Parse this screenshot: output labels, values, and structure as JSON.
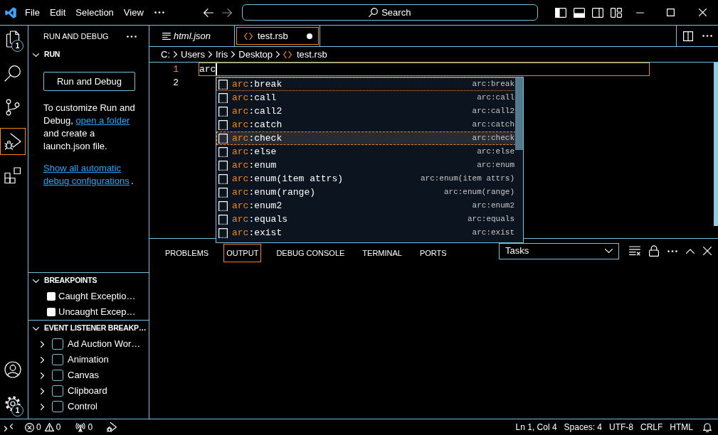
{
  "title_bar": {
    "menus": [
      {
        "label": "File"
      },
      {
        "label": "Edit"
      },
      {
        "label": "Selection"
      },
      {
        "label": "View"
      }
    ],
    "navigation": [
      {
        "kind": "back",
        "disabled": false
      },
      {
        "kind": "forward",
        "disabled": true
      }
    ],
    "search": {
      "label": "Search"
    },
    "layout_toggles": [
      {
        "kind": "primary_sidebar",
        "on": true
      },
      {
        "kind": "panel",
        "on": true
      },
      {
        "kind": "secondary_sidebar",
        "on": false
      }
    ]
  },
  "activity_bar": {
    "items": [
      {
        "kind": "explorer",
        "selected": false,
        "badge": "1"
      },
      {
        "kind": "search",
        "selected": false
      },
      {
        "kind": "source_control",
        "selected": false
      },
      {
        "kind": "run_debug",
        "selected": true
      },
      {
        "kind": "extensions",
        "selected": false
      }
    ],
    "bottom_items": [
      {
        "kind": "accounts"
      },
      {
        "kind": "settings",
        "badge": "1"
      }
    ]
  },
  "sidebar": {
    "title": "RUN AND DEBUG",
    "sections": [
      {
        "kind": "run",
        "title": "RUN",
        "expanded": true,
        "button": "Run and Debug",
        "message": {
          "text_before": "To customize Run and Debug,",
          "link": "open a folder",
          "text_after": "and create a launch.json file."
        },
        "configurations": {
          "link": "Show all automatic debug configurations",
          "text_after": "."
        }
      },
      {
        "kind": "checklist",
        "title": "BREAKPOINTS",
        "expanded": true,
        "items": [
          {
            "label": "Caught Exceptio…",
            "checked": false
          },
          {
            "label": "Uncaught Excep…",
            "checked": false
          }
        ]
      },
      {
        "kind": "tree",
        "title": "EVENT LISTENER BREAKP…",
        "expanded": true,
        "items": [
          {
            "label": "Ad Auction Wor…",
            "expanded": false,
            "checked": false
          },
          {
            "label": "Animation",
            "expanded": false,
            "checked": false
          },
          {
            "label": "Canvas",
            "expanded": false,
            "checked": false
          },
          {
            "label": "Clipboard",
            "expanded": false,
            "checked": false
          },
          {
            "label": "Control",
            "expanded": false,
            "checked": false
          }
        ]
      }
    ]
  },
  "editor": {
    "tabs": [
      {
        "label": "html.json",
        "kind": "json",
        "selected": false,
        "preview": true,
        "modified": false
      },
      {
        "label": "test.rsb",
        "kind": "code",
        "selected": true,
        "preview": false,
        "modified": true
      }
    ],
    "breadcrumbs": [
      {
        "label": "C:",
        "kind": "folder"
      },
      {
        "label": "Users",
        "kind": "folder"
      },
      {
        "label": "Iris",
        "kind": "folder"
      },
      {
        "label": "Desktop",
        "kind": "folder"
      },
      {
        "label": "test.rsb",
        "kind": "file"
      }
    ],
    "lines": [
      {
        "number": "1",
        "text": "arc",
        "current": true
      },
      {
        "number": "2",
        "current": false
      }
    ],
    "suggestions": [
      {
        "match": "arc",
        "rest": ":break",
        "detail": "arc:break",
        "selected": false,
        "hovered": true
      },
      {
        "match": "arc",
        "rest": ":call",
        "detail": "arc:call",
        "selected": false,
        "hovered": false
      },
      {
        "match": "arc",
        "rest": ":call2",
        "detail": "arc:call2",
        "selected": false,
        "hovered": false
      },
      {
        "match": "arc",
        "rest": ":catch",
        "detail": "arc:catch",
        "selected": false,
        "hovered": false
      },
      {
        "match": "arc",
        "rest": ":check",
        "detail": "arc:check",
        "selected": true,
        "hovered": false
      },
      {
        "match": "arc",
        "rest": ":else",
        "detail": "arc:else",
        "selected": false,
        "hovered": false
      },
      {
        "match": "arc",
        "rest": ":enum",
        "detail": "arc:enum",
        "selected": false,
        "hovered": false
      },
      {
        "match": "arc",
        "rest": ":enum(item attrs)",
        "detail": "arc:enum(item attrs)",
        "selected": false,
        "hovered": false
      },
      {
        "match": "arc",
        "rest": ":enum(range)",
        "detail": "arc:enum(range)",
        "selected": false,
        "hovered": false
      },
      {
        "match": "arc",
        "rest": ":enum2",
        "detail": "arc:enum2",
        "selected": false,
        "hovered": false
      },
      {
        "match": "arc",
        "rest": ":equals",
        "detail": "arc:equals",
        "selected": false,
        "hovered": false
      },
      {
        "match": "arc",
        "rest": ":exist",
        "detail": "arc:exist",
        "selected": false,
        "hovered": false
      }
    ]
  },
  "panel": {
    "tabs": [
      {
        "label": "PROBLEMS",
        "selected": false
      },
      {
        "label": "OUTPUT",
        "selected": true
      },
      {
        "label": "DEBUG CONSOLE",
        "selected": false
      },
      {
        "label": "TERMINAL",
        "selected": false
      },
      {
        "label": "PORTS",
        "selected": false
      }
    ],
    "dropdown": {
      "value": "Tasks"
    }
  },
  "status_bar": {
    "errors": "0",
    "warnings": "0",
    "ports": "0",
    "right_items": [
      {
        "label": "Ln 1, Col 4"
      },
      {
        "label": "Spaces: 4"
      },
      {
        "label": "UTF-8"
      },
      {
        "label": "CRLF"
      },
      {
        "label": "HTML"
      }
    ]
  }
}
